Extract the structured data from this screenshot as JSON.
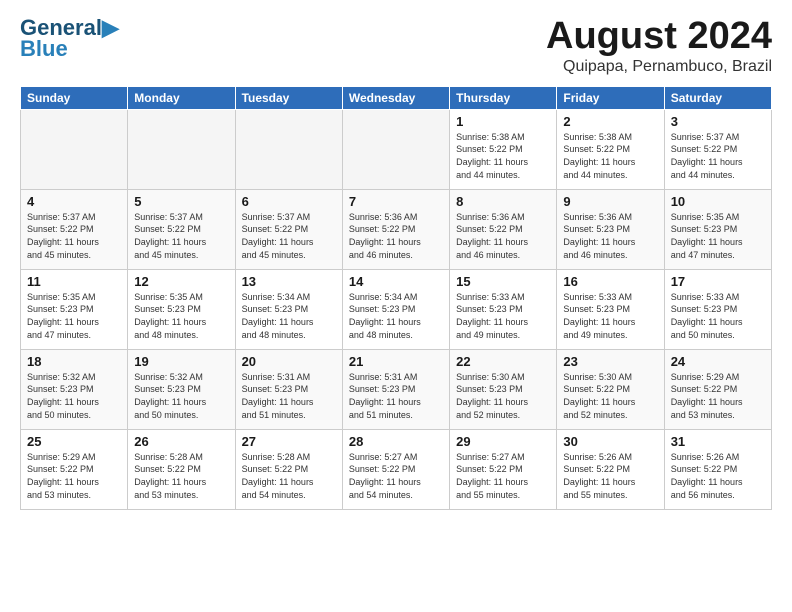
{
  "logo": {
    "line1": "General",
    "line2": "Blue"
  },
  "title": "August 2024",
  "subtitle": "Quipapa, Pernambuco, Brazil",
  "days_of_week": [
    "Sunday",
    "Monday",
    "Tuesday",
    "Wednesday",
    "Thursday",
    "Friday",
    "Saturday"
  ],
  "weeks": [
    [
      {
        "day": "",
        "info": ""
      },
      {
        "day": "",
        "info": ""
      },
      {
        "day": "",
        "info": ""
      },
      {
        "day": "",
        "info": ""
      },
      {
        "day": "1",
        "info": "Sunrise: 5:38 AM\nSunset: 5:22 PM\nDaylight: 11 hours\nand 44 minutes."
      },
      {
        "day": "2",
        "info": "Sunrise: 5:38 AM\nSunset: 5:22 PM\nDaylight: 11 hours\nand 44 minutes."
      },
      {
        "day": "3",
        "info": "Sunrise: 5:37 AM\nSunset: 5:22 PM\nDaylight: 11 hours\nand 44 minutes."
      }
    ],
    [
      {
        "day": "4",
        "info": "Sunrise: 5:37 AM\nSunset: 5:22 PM\nDaylight: 11 hours\nand 45 minutes."
      },
      {
        "day": "5",
        "info": "Sunrise: 5:37 AM\nSunset: 5:22 PM\nDaylight: 11 hours\nand 45 minutes."
      },
      {
        "day": "6",
        "info": "Sunrise: 5:37 AM\nSunset: 5:22 PM\nDaylight: 11 hours\nand 45 minutes."
      },
      {
        "day": "7",
        "info": "Sunrise: 5:36 AM\nSunset: 5:22 PM\nDaylight: 11 hours\nand 46 minutes."
      },
      {
        "day": "8",
        "info": "Sunrise: 5:36 AM\nSunset: 5:22 PM\nDaylight: 11 hours\nand 46 minutes."
      },
      {
        "day": "9",
        "info": "Sunrise: 5:36 AM\nSunset: 5:23 PM\nDaylight: 11 hours\nand 46 minutes."
      },
      {
        "day": "10",
        "info": "Sunrise: 5:35 AM\nSunset: 5:23 PM\nDaylight: 11 hours\nand 47 minutes."
      }
    ],
    [
      {
        "day": "11",
        "info": "Sunrise: 5:35 AM\nSunset: 5:23 PM\nDaylight: 11 hours\nand 47 minutes."
      },
      {
        "day": "12",
        "info": "Sunrise: 5:35 AM\nSunset: 5:23 PM\nDaylight: 11 hours\nand 48 minutes."
      },
      {
        "day": "13",
        "info": "Sunrise: 5:34 AM\nSunset: 5:23 PM\nDaylight: 11 hours\nand 48 minutes."
      },
      {
        "day": "14",
        "info": "Sunrise: 5:34 AM\nSunset: 5:23 PM\nDaylight: 11 hours\nand 48 minutes."
      },
      {
        "day": "15",
        "info": "Sunrise: 5:33 AM\nSunset: 5:23 PM\nDaylight: 11 hours\nand 49 minutes."
      },
      {
        "day": "16",
        "info": "Sunrise: 5:33 AM\nSunset: 5:23 PM\nDaylight: 11 hours\nand 49 minutes."
      },
      {
        "day": "17",
        "info": "Sunrise: 5:33 AM\nSunset: 5:23 PM\nDaylight: 11 hours\nand 50 minutes."
      }
    ],
    [
      {
        "day": "18",
        "info": "Sunrise: 5:32 AM\nSunset: 5:23 PM\nDaylight: 11 hours\nand 50 minutes."
      },
      {
        "day": "19",
        "info": "Sunrise: 5:32 AM\nSunset: 5:23 PM\nDaylight: 11 hours\nand 50 minutes."
      },
      {
        "day": "20",
        "info": "Sunrise: 5:31 AM\nSunset: 5:23 PM\nDaylight: 11 hours\nand 51 minutes."
      },
      {
        "day": "21",
        "info": "Sunrise: 5:31 AM\nSunset: 5:23 PM\nDaylight: 11 hours\nand 51 minutes."
      },
      {
        "day": "22",
        "info": "Sunrise: 5:30 AM\nSunset: 5:23 PM\nDaylight: 11 hours\nand 52 minutes."
      },
      {
        "day": "23",
        "info": "Sunrise: 5:30 AM\nSunset: 5:22 PM\nDaylight: 11 hours\nand 52 minutes."
      },
      {
        "day": "24",
        "info": "Sunrise: 5:29 AM\nSunset: 5:22 PM\nDaylight: 11 hours\nand 53 minutes."
      }
    ],
    [
      {
        "day": "25",
        "info": "Sunrise: 5:29 AM\nSunset: 5:22 PM\nDaylight: 11 hours\nand 53 minutes."
      },
      {
        "day": "26",
        "info": "Sunrise: 5:28 AM\nSunset: 5:22 PM\nDaylight: 11 hours\nand 53 minutes."
      },
      {
        "day": "27",
        "info": "Sunrise: 5:28 AM\nSunset: 5:22 PM\nDaylight: 11 hours\nand 54 minutes."
      },
      {
        "day": "28",
        "info": "Sunrise: 5:27 AM\nSunset: 5:22 PM\nDaylight: 11 hours\nand 54 minutes."
      },
      {
        "day": "29",
        "info": "Sunrise: 5:27 AM\nSunset: 5:22 PM\nDaylight: 11 hours\nand 55 minutes."
      },
      {
        "day": "30",
        "info": "Sunrise: 5:26 AM\nSunset: 5:22 PM\nDaylight: 11 hours\nand 55 minutes."
      },
      {
        "day": "31",
        "info": "Sunrise: 5:26 AM\nSunset: 5:22 PM\nDaylight: 11 hours\nand 56 minutes."
      }
    ]
  ]
}
